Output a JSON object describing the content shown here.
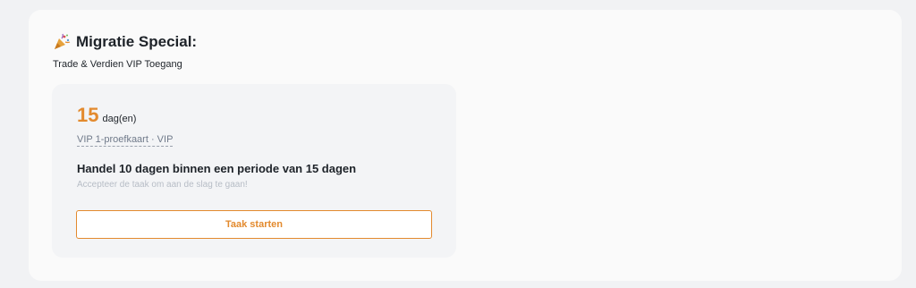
{
  "header": {
    "icon": "party-popper-icon",
    "title": "Migratie Special:",
    "subtitle": "Trade & Verdien VIP Toegang"
  },
  "card": {
    "days_number": "15",
    "days_unit": "dag(en)",
    "card_type": "VIP 1-proefkaart · VIP",
    "task_title": "Handel 10 dagen binnen een periode van 15 dagen",
    "task_description": "Accepteer de taak om aan de slag te gaan!",
    "start_button_label": "Taak starten"
  },
  "colors": {
    "accent": "#e38a2e",
    "text_primary": "#1e2329",
    "text_muted": "#b7bdc6"
  }
}
